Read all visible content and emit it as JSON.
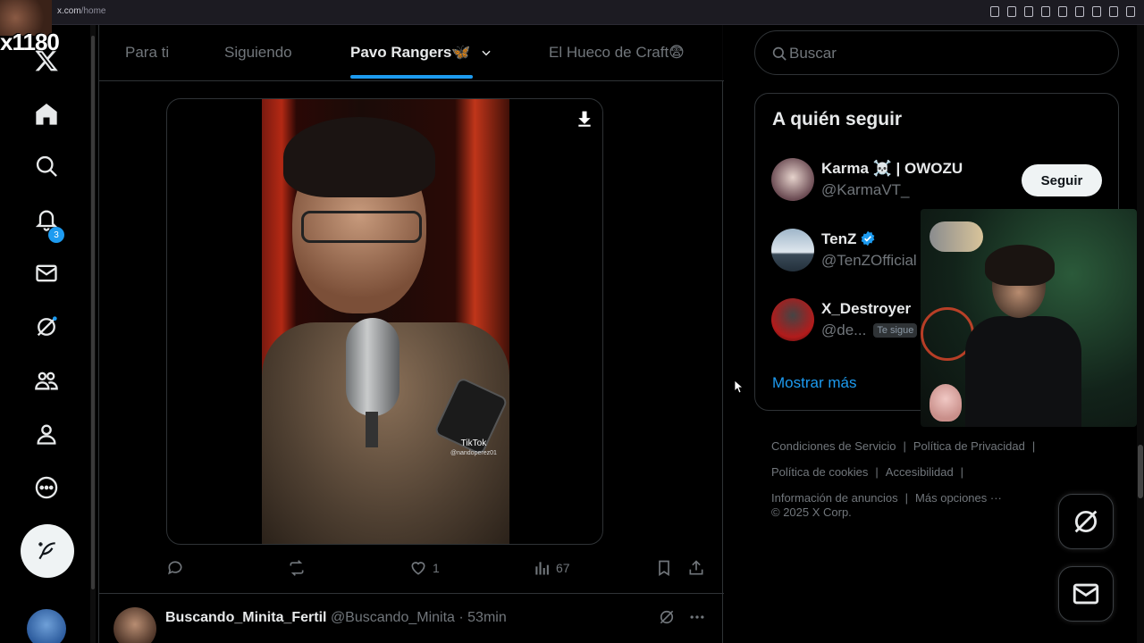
{
  "browser": {
    "url_host": "x.com",
    "url_path": "/home"
  },
  "stream": {
    "overlay_label": "x1180"
  },
  "nav": {
    "notifications_badge": "3",
    "icons": [
      "x-logo-icon",
      "home-icon",
      "search-icon",
      "bell-icon",
      "mail-icon",
      "grok-icon",
      "communities-icon",
      "profile-icon",
      "more-icon"
    ]
  },
  "tabs": [
    {
      "label": "Para ti",
      "active": false
    },
    {
      "label": "Siguiendo",
      "active": false
    },
    {
      "label": "Pavo Rangers🦋",
      "active": true
    },
    {
      "label": "El Hueco de Craft😨",
      "active": false
    }
  ],
  "post": {
    "video_watermark_brand": "TikTok",
    "video_watermark_handle": "@nandoperez01",
    "likes": "1",
    "views": "67"
  },
  "next_post": {
    "name": "Buscando_Minita_Fertil",
    "handle": "@Buscando_Minita",
    "time": "53min"
  },
  "search": {
    "placeholder": "Buscar"
  },
  "who_to_follow": {
    "title": "A quién seguir",
    "users": [
      {
        "name": "Karma ☠️ | OWOZU",
        "handle": "@KarmaVT_",
        "verified": false,
        "follows_you": false
      },
      {
        "name": "TenZ",
        "handle": "@TenZOfficial",
        "verified": true,
        "follows_you": false
      },
      {
        "name": "X_Destroyer",
        "handle": "@de...",
        "verified": false,
        "follows_you": true
      }
    ],
    "follow_label": "Seguir",
    "follows_you_label": "Te sigue",
    "show_more": "Mostrar más"
  },
  "footer": {
    "links": [
      "Condiciones de Servicio",
      "Política de Privacidad",
      "Política de cookies",
      "Accesibilidad",
      "Información de anuncios",
      "Más opciones ···"
    ],
    "copyright": "© 2025 X Corp."
  },
  "colors": {
    "accent": "#1d9bf0",
    "background": "#000000",
    "text_primary": "#e7e9ea",
    "text_secondary": "#71767b",
    "border": "#2f3336"
  }
}
